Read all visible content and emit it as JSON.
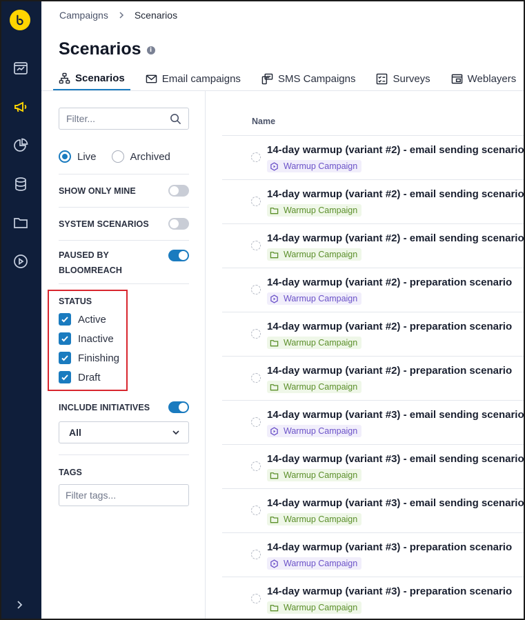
{
  "breadcrumb": {
    "parent": "Campaigns",
    "current": "Scenarios"
  },
  "page": {
    "title": "Scenarios"
  },
  "tabs": [
    {
      "label": "Scenarios",
      "icon": "hierarchy-icon",
      "active": true
    },
    {
      "label": "Email campaigns",
      "icon": "envelope-icon"
    },
    {
      "label": "SMS Campaigns",
      "icon": "sms-icon"
    },
    {
      "label": "Surveys",
      "icon": "survey-checklist-icon"
    },
    {
      "label": "Weblayers",
      "icon": "weblayer-icon"
    }
  ],
  "filters": {
    "search_placeholder": "Filter...",
    "state": {
      "live": "Live",
      "archived": "Archived",
      "selected": "Live"
    },
    "show_only_mine": {
      "label": "SHOW ONLY MINE",
      "on": false
    },
    "system_scenarios": {
      "label": "SYSTEM SCENARIOS",
      "on": false
    },
    "paused_by": {
      "label": "PAUSED BY BLOOMREACH",
      "on": true
    },
    "status": {
      "title": "STATUS",
      "options": [
        {
          "label": "Active",
          "checked": true
        },
        {
          "label": "Inactive",
          "checked": true
        },
        {
          "label": "Finishing",
          "checked": true
        },
        {
          "label": "Draft",
          "checked": true
        }
      ]
    },
    "include_initiatives": {
      "label": "INCLUDE INITIATIVES",
      "on": true,
      "value": "All"
    },
    "tags": {
      "title": "TAGS",
      "placeholder": "Filter tags..."
    }
  },
  "list": {
    "column_name": "Name",
    "rows": [
      {
        "title": "14-day warmup (variant #2) - email sending scenario",
        "tag": "Warmup Campaign",
        "tag_kind": "initiative"
      },
      {
        "title": "14-day warmup (variant #2) - email sending scenario",
        "tag": "Warmup Campaign",
        "tag_kind": "folder"
      },
      {
        "title": "14-day warmup (variant #2) - email sending scenario",
        "tag": "Warmup Campaign",
        "tag_kind": "folder"
      },
      {
        "title": "14-day warmup (variant #2) - preparation scenario",
        "tag": "Warmup Campaign",
        "tag_kind": "initiative"
      },
      {
        "title": "14-day warmup (variant #2) - preparation scenario",
        "tag": "Warmup Campaign",
        "tag_kind": "folder"
      },
      {
        "title": "14-day warmup (variant #2) - preparation scenario",
        "tag": "Warmup Campaign",
        "tag_kind": "folder"
      },
      {
        "title": "14-day warmup (variant #3) - email sending scenario",
        "tag": "Warmup Campaign",
        "tag_kind": "initiative"
      },
      {
        "title": "14-day warmup (variant #3) - email sending scenario",
        "tag": "Warmup Campaign",
        "tag_kind": "folder"
      },
      {
        "title": "14-day warmup (variant #3) - email sending scenario",
        "tag": "Warmup Campaign",
        "tag_kind": "folder"
      },
      {
        "title": "14-day warmup (variant #3) - preparation scenario",
        "tag": "Warmup Campaign",
        "tag_kind": "initiative"
      },
      {
        "title": "14-day warmup (variant #3) - preparation scenario",
        "tag": "Warmup Campaign",
        "tag_kind": "folder"
      }
    ]
  },
  "colors": {
    "nav_bg": "#0f1e3a",
    "accent": "#1a7bbf",
    "brand": "#ffd500",
    "highlight_box": "#d8262e"
  }
}
